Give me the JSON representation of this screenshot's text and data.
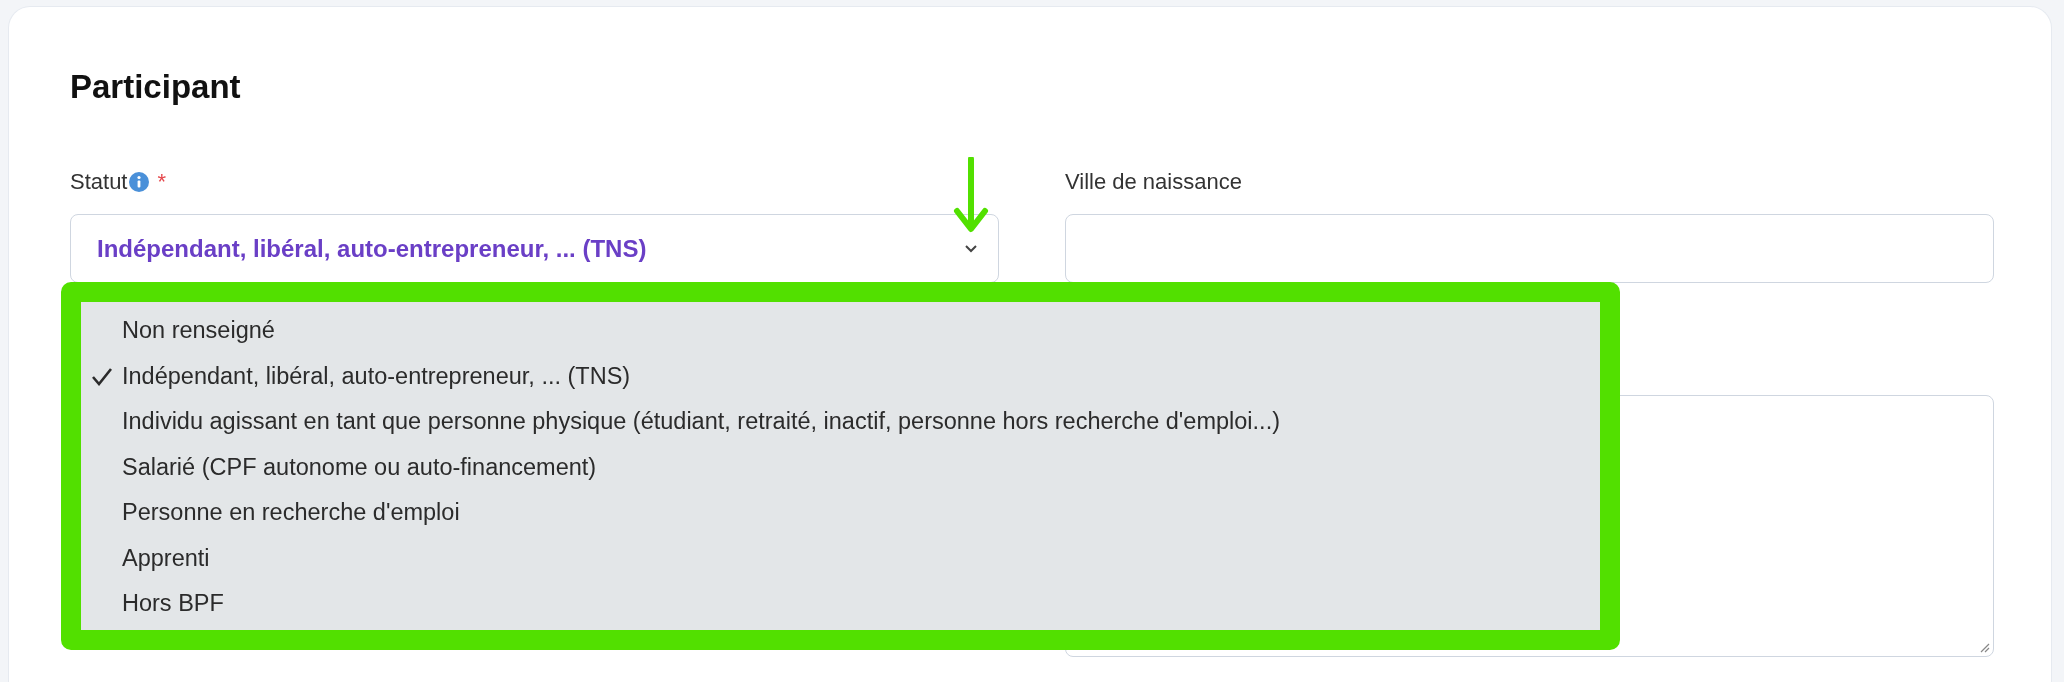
{
  "section": {
    "title": "Participant"
  },
  "fields": [
    {
      "kind": "select",
      "label": "Statut",
      "info": true,
      "required_mark": "*",
      "value": "Indépendant, libéral, auto-entrepreneur, ... (TNS)",
      "expanded": true
    },
    {
      "kind": "text",
      "label": "Ville de naissance"
    },
    {
      "kind": "textarea"
    }
  ],
  "dropdown": {
    "options": [
      {
        "label": "Non renseigné",
        "selected": false
      },
      {
        "label": "Indépendant, libéral, auto-entrepreneur, ... (TNS)",
        "selected": true
      },
      {
        "label": "Individu agissant en tant que personne physique (étudiant, retraité, inactif, personne hors recherche d'emploi...)",
        "selected": false
      },
      {
        "label": "Salarié (CPF autonome ou auto-financement)",
        "selected": false
      },
      {
        "label": "Personne en recherche d'emploi",
        "selected": false
      },
      {
        "label": "Apprenti",
        "selected": false
      },
      {
        "label": "Hors BPF",
        "selected": false
      }
    ]
  }
}
